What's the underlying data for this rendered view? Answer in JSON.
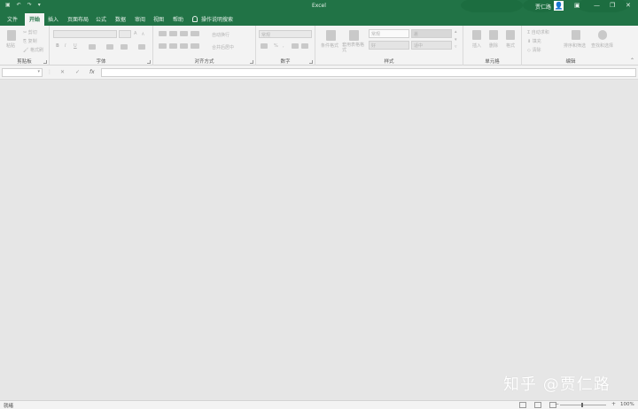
{
  "titlebar": {
    "title": "Excel",
    "user": "贾仁路",
    "save_icon": "save-icon",
    "undo_icon": "undo-icon",
    "redo_icon": "redo-icon",
    "customize": "▾",
    "min": "—",
    "restore": "❐",
    "close": "✕",
    "options": "▣"
  },
  "tabs": [
    "文件",
    "开始",
    "插入",
    "页面布局",
    "公式",
    "数据",
    "审阅",
    "视图",
    "帮助"
  ],
  "tell_me": "操作说明搜索",
  "ribbon": {
    "clipboard": {
      "label": "剪贴板",
      "paste": "粘贴",
      "cut": "剪切",
      "copy": "复制",
      "format_painter": "格式刷"
    },
    "font": {
      "label": "字体",
      "bold": "B",
      "italic": "I",
      "underline": "U",
      "grow": "A",
      "shrink": "A"
    },
    "alignment": {
      "label": "对齐方式",
      "wrap": "自动换行",
      "merge": "合并后居中"
    },
    "number": {
      "label": "数字",
      "format": "常规",
      "percent": "%",
      "comma": ","
    },
    "styles": {
      "label": "样式",
      "cond": "条件格式",
      "table": "套用表格格式",
      "normal": "常规",
      "bad": "差",
      "good": "好",
      "neutral": "适中"
    },
    "cells": {
      "label": "单元格",
      "insert": "插入",
      "delete": "删除",
      "format": "格式"
    },
    "editing": {
      "label": "编辑",
      "autosum": "自动求和",
      "fill": "填充",
      "clear": "清除",
      "sort": "排序和筛选",
      "find": "查找和选择"
    }
  },
  "formula_bar": {
    "cancel": "✕",
    "enter": "✓",
    "fx": "fx"
  },
  "status": {
    "text": "就绪",
    "zoom": "100%"
  },
  "watermark": "知乎 @贾仁路",
  "colors": {
    "brand": "#217346",
    "ribbon": "#f3f3f3",
    "sheet": "#e6e6e6"
  }
}
